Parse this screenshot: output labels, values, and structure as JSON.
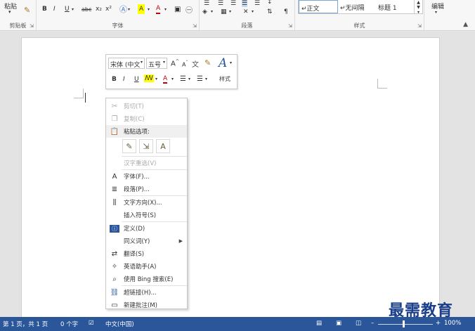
{
  "ribbon": {
    "clipboard": {
      "paste_label": "粘贴",
      "group_label": "剪贴板"
    },
    "font": {
      "group_label": "字体",
      "bold": "B",
      "italic": "I",
      "underline": "U",
      "strike": "abc",
      "subscript": "x₂",
      "superscript": "x²",
      "font_color": "A",
      "highlight": "A"
    },
    "paragraph": {
      "group_label": "段落"
    },
    "styles": {
      "group_label": "样式",
      "items": [
        "↵正文",
        "↵无间隔",
        "标题 1"
      ]
    },
    "editing": {
      "label": "编辑"
    }
  },
  "minitoolbar": {
    "font_name": "宋体 (中文",
    "font_size": "五号",
    "grow": "A",
    "shrink": "A",
    "bold": "B",
    "italic": "I",
    "underline": "U",
    "font_color": "A",
    "style_label": "样式"
  },
  "context_menu": {
    "cut": "剪切(T)",
    "copy": "复制(C)",
    "paste_options": "粘贴选项:",
    "reconvert": "汉字重选(V)",
    "font": "字体(F)...",
    "paragraph": "段落(P)...",
    "text_direction": "文字方向(X)...",
    "insert_symbol": "插入符号(S)",
    "define": "定义(D)",
    "synonyms": "同义词(Y)",
    "translate": "翻译(S)",
    "english_assistant": "英语助手(A)",
    "bing_search": "使用 Bing 搜索(E)",
    "hyperlink": "超链接(H)...",
    "new_comment": "新建批注(M)"
  },
  "status_bar": {
    "page": "第 1 页，共 1 页",
    "words": "0 个字",
    "language": "中文(中国)",
    "zoom": "100%"
  },
  "watermark": "最需教育",
  "colors": {
    "status_bg": "#2b579a",
    "ribbon_bg": "#f7f7f7"
  }
}
